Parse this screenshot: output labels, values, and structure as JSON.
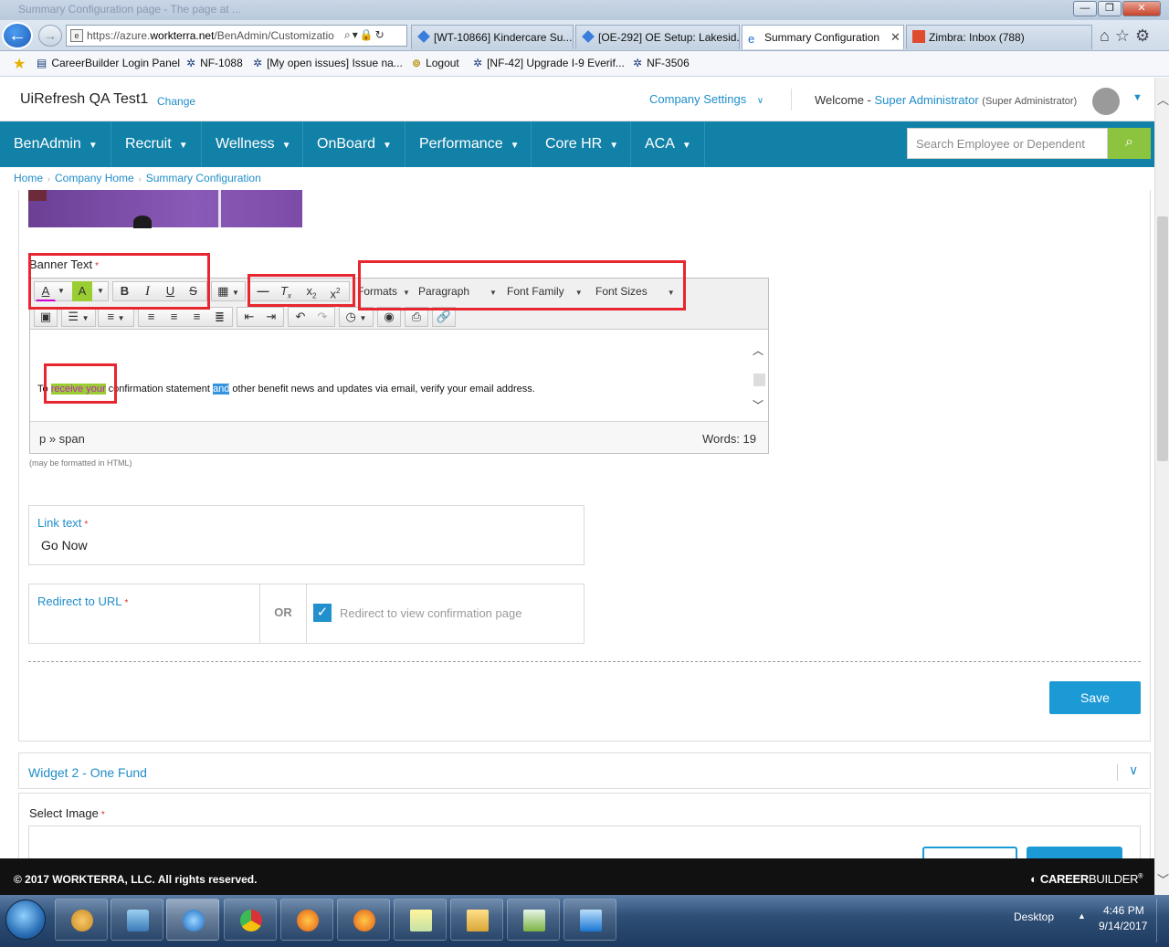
{
  "browser": {
    "faint_title": "Summary Configuration page - The page at ...",
    "url_prefix": "https://azure.",
    "url_domain": "workterra.net",
    "url_path": "/BenAdmin/Customizatio",
    "url_tools": "⌕▾🔒↻",
    "tabs": [
      {
        "label": "[WT-10866] Kindercare Su...",
        "active": false
      },
      {
        "label": "[OE-292] OE Setup: Lakesid...",
        "active": false
      },
      {
        "label": "Summary Configuration",
        "active": true
      },
      {
        "label": "Zimbra: Inbox (788)",
        "active": false
      }
    ],
    "favorites": [
      "CareerBuilder Login Panel",
      "NF-1088",
      "[My open issues] Issue na...",
      "Logout",
      "[NF-42] Upgrade I-9 Everif...",
      "NF-3506"
    ]
  },
  "header": {
    "company": "UiRefresh QA Test1",
    "change": "Change",
    "settings": "Company Settings",
    "welcome_prefix": "Welcome - ",
    "user": "Super Administrator",
    "role": "(Super Administrator)"
  },
  "nav": {
    "items": [
      "BenAdmin",
      "Recruit",
      "Wellness",
      "OnBoard",
      "Performance",
      "Core HR",
      "ACA"
    ],
    "search_placeholder": "Search Employee or Dependent"
  },
  "breadcrumb": [
    "Home",
    "Company Home",
    "Summary Configuration"
  ],
  "editor": {
    "label": "Banner Text",
    "req": "*",
    "dropdowns": {
      "formats": "Formats",
      "paragraph": "Paragraph",
      "font_family": "Font Family",
      "font_sizes": "Font Sizes"
    },
    "text_before": "To ",
    "text_highlight": "receive your",
    "text_middle": " confirmation statement ",
    "text_selected": "and",
    "text_after": " other benefit news and updates via email, verify your email address.",
    "path": "p » span",
    "words": "Words: 19",
    "note": "(may be formatted in HTML)"
  },
  "form": {
    "link_label": "Link text",
    "link_value": "Go Now",
    "redirect_label": "Redirect to URL",
    "or": "OR",
    "redirect_checkbox": "Redirect to view confirmation page",
    "save": "Save"
  },
  "widget2": {
    "title": "Widget 2 - One Fund",
    "select_label": "Select Image"
  },
  "footer": {
    "copyright": "© 2017 WORKTERRA, LLC. All rights reserved.",
    "logo_bold": "CAREER",
    "logo_light": "BUILDER",
    "logo_tm": "®"
  },
  "taskbar": {
    "desktop": "Desktop",
    "time": "4:46 PM",
    "date": "9/14/2017"
  },
  "colors": {
    "nav": "#1281a7",
    "link": "#1f8dc9",
    "search_btn": "#8cc43f",
    "save_btn": "#1c9ad6",
    "annotation": "#e8262f"
  }
}
